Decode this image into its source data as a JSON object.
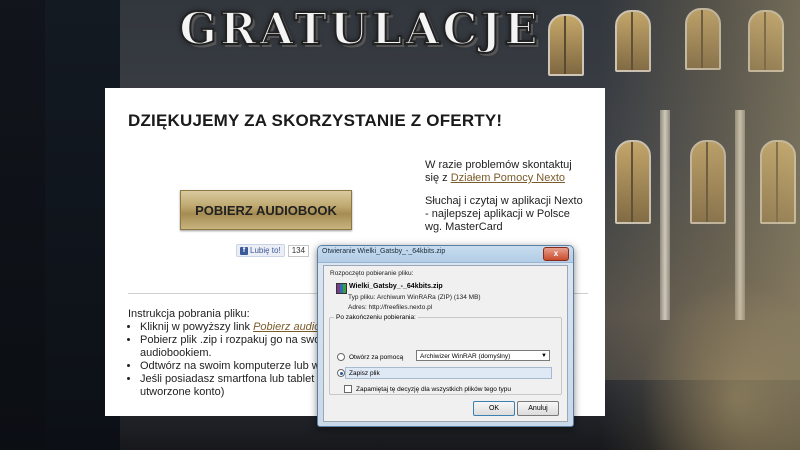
{
  "header": {
    "title": "GRATULACJE"
  },
  "card": {
    "heading": "DZIĘKUJEMY ZA SKORZYSTANIE Z OFERTY!",
    "download_button": "POBIERZ AUDIOBOOK",
    "like": {
      "label": "Lubię to!",
      "count": "134"
    },
    "side": {
      "problems_prefix": "W razie problemów skontaktuj się z ",
      "problems_link": "Działem Pomocy Nexto",
      "app_text": "Słuchaj i czytaj w aplikacji Nexto - najlepszej aplikacji w Polsce wg. MasterCard"
    },
    "instructions": {
      "heading": "Instrukcja pobrania pliku:",
      "item1_prefix": "Kliknij w powyższy link ",
      "item1_link": "Pobierz audiobook",
      "item2": "Pobierz plik .zip i rozpakuj go na swoim dysku - tam znajdziesz pliki mp3 ze swoim audiobookiem.",
      "item3": "Odtwórz na swoim komputerze lub wgraj na odtwarzacz mp3.",
      "item4": "Jeśli posiadasz smartfona lub tablet pobierz aplikację Nexto (zaloguj się na przed chwilą utworzone konto)"
    }
  },
  "dialog": {
    "title": "Otwieranie Wielki_Gatsby_-_64kbits.zip",
    "close_label": "x",
    "started": "Rozpoczęto pobieranie pliku:",
    "filename": "Wielki_Gatsby_-_64kbits.zip",
    "type_label": "Typ pliku:",
    "type_value": "Archiwum WinRARa (ZIP) (134 MB)",
    "address_label": "Adres:",
    "address_value": "http://freefiles.nexto.pl",
    "group_label": "Po zakończeniu pobierania:",
    "open_with_label": "Otwórz za pomocą",
    "open_with_value": "Archiwizer WinRAR (domyślny)",
    "save_label": "Zapisz plik",
    "remember_label": "Zapamiętaj tę decyzję dla wszystkich plików tego typu",
    "ok": "OK",
    "cancel": "Anuluj"
  }
}
